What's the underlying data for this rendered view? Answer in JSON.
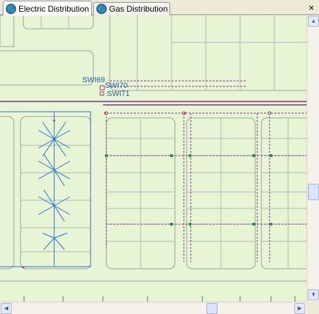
{
  "tabs": [
    {
      "label": "Electric Distribution",
      "active": true
    },
    {
      "label": "Gas Distribution",
      "active": false
    }
  ],
  "close_label": "×",
  "map": {
    "switch_labels": [
      "SWI69",
      "SWI70",
      "SWI71"
    ],
    "colors": {
      "parcel_fill": "#e7f5d4",
      "parcel_line": "#a9a9a9",
      "road_line": "#9a9a9a",
      "electric_line": "#1e6fd0",
      "gas_line": "#7a2b8c",
      "switch_label": "#1f5aa8"
    }
  },
  "scroll": {
    "up_icon": "▲",
    "down_icon": "▼",
    "left_icon": "◀",
    "right_icon": "▶"
  }
}
